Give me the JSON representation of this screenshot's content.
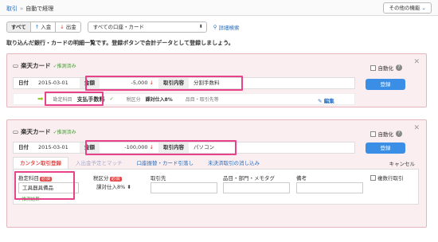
{
  "breadcrumb": {
    "parent": "取引",
    "separator": "»",
    "current": "自動で経理"
  },
  "other_button": "その他の機能",
  "filters": {
    "all": "すべて",
    "income": "入金",
    "expense": "出金",
    "account_select": "すべての口座・カード",
    "advanced": "詳細検索"
  },
  "description": "取り込んだ銀行・カードの明細一覧です。登録ボタンで会計データとして登録しましょう。",
  "cards": [
    {
      "title": "楽天カード",
      "status": "推測済み",
      "auto_label": "自動化",
      "register": "登録",
      "date_label": "日付",
      "date": "2015-03-01",
      "amount_label": "金額",
      "amount": "-5,000",
      "content_label": "取引内容",
      "content": "分割手数料",
      "account_label": "勘定科目",
      "account": "支払手数料",
      "tax_label": "税区分",
      "tax": "課対仕入8%",
      "items_label": "品目・取引先等",
      "edit": "編集"
    },
    {
      "title": "楽天カード",
      "status": "推測済み",
      "auto_label": "自動化",
      "register": "登録",
      "date_label": "日付",
      "date": "2015-03-01",
      "amount_label": "金額",
      "amount": "-100,000",
      "content_label": "取引内容",
      "content": "パソコン",
      "tabs": [
        "カンタン取引登録",
        "入出金予定とマッチ",
        "口座振替・カード引落し",
        "未決済取引の消し込み"
      ],
      "cancel": "キャンセル",
      "form": {
        "account_label": "勘定科目",
        "required": "必須",
        "tax_label": "税区分",
        "partner_label": "取引先",
        "items_label": "品目・部門・メモタグ",
        "note_label": "備考",
        "multiple": "複数行取引",
        "account_value": "工具器具備品",
        "tax_value": "課対仕入8%",
        "estimated": "推測結果"
      }
    }
  ]
}
